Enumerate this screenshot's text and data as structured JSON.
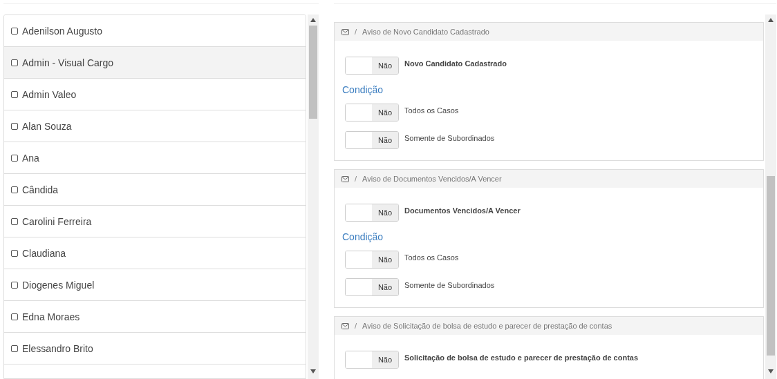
{
  "people": [
    {
      "name": "Adenilson Augusto",
      "checked": false,
      "selected": false
    },
    {
      "name": "Admin - Visual Cargo",
      "checked": false,
      "selected": true
    },
    {
      "name": "Admin Valeo",
      "checked": false,
      "selected": false
    },
    {
      "name": "Alan Souza",
      "checked": false,
      "selected": false
    },
    {
      "name": "Ana",
      "checked": false,
      "selected": false
    },
    {
      "name": "Cândida",
      "checked": false,
      "selected": false
    },
    {
      "name": "Carolini Ferreira",
      "checked": false,
      "selected": false
    },
    {
      "name": "Claudiana",
      "checked": false,
      "selected": false
    },
    {
      "name": "Diogenes Miguel",
      "checked": false,
      "selected": false
    },
    {
      "name": "Edna Moraes",
      "checked": false,
      "selected": false
    },
    {
      "name": "Elessandro Brito",
      "checked": false,
      "selected": false
    }
  ],
  "notices": [
    {
      "separator": "/",
      "title": "Aviso de Novo Candidato Cadastrado",
      "main": {
        "label": "Novo Candidato Cadastrado",
        "on": false,
        "state_text": "Não"
      },
      "condition_heading": "Condição",
      "conditions": [
        {
          "label": "Todos os Casos",
          "on": false,
          "state_text": "Não"
        },
        {
          "label": "Somente de Subordinados",
          "on": false,
          "state_text": "Não"
        }
      ]
    },
    {
      "separator": "/",
      "title": "Aviso de Documentos Vencidos/A Vencer",
      "main": {
        "label": "Documentos Vencidos/A Vencer",
        "on": false,
        "state_text": "Não"
      },
      "condition_heading": "Condição",
      "conditions": [
        {
          "label": "Todos os Casos",
          "on": false,
          "state_text": "Não"
        },
        {
          "label": "Somente de Subordinados",
          "on": false,
          "state_text": "Não"
        }
      ]
    },
    {
      "separator": "/",
      "title": "Aviso de Solicitação de bolsa de estudo e parecer de prestação de contas",
      "main": {
        "label": "Solicitação de bolsa de estudo e parecer de prestação de contas",
        "on": false,
        "state_text": "Não"
      }
    }
  ]
}
